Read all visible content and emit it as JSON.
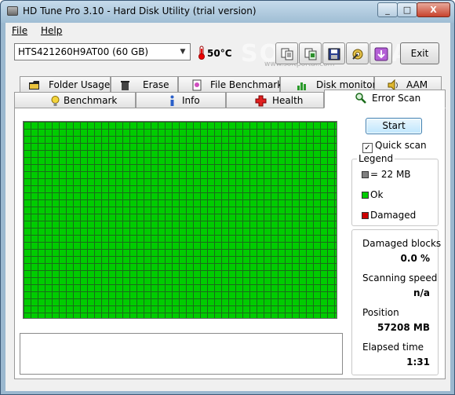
{
  "window": {
    "title": "HD Tune Pro 3.10 - Hard Disk Utility (trial version)",
    "minimize": "_",
    "maximize": "□",
    "close": "X"
  },
  "menu": {
    "file": "File",
    "help": "Help"
  },
  "toolbar": {
    "drive": "HTS421260H9AT00 (60 GB)",
    "temperature": "50°C",
    "exit_label": "Exit",
    "watermark": "SOFTPORTAL",
    "watermark_sub": "www.softportal.com",
    "icons": [
      "copy-icon",
      "copy-screenshot-icon",
      "save-icon",
      "options-icon",
      "download-icon"
    ]
  },
  "tabs": {
    "row1": [
      {
        "label": "Folder Usage",
        "icon": "folder-icon"
      },
      {
        "label": "Erase",
        "icon": "trash-icon"
      },
      {
        "label": "File Benchmark",
        "icon": "file-benchmark-icon"
      },
      {
        "label": "Disk monitor",
        "icon": "disk-monitor-icon"
      },
      {
        "label": "AAM",
        "icon": "speaker-icon"
      }
    ],
    "row2": [
      {
        "label": "Benchmark",
        "icon": "lightbulb-icon"
      },
      {
        "label": "Info",
        "icon": "info-icon"
      },
      {
        "label": "Health",
        "icon": "health-cross-icon"
      },
      {
        "label": "Error Scan",
        "icon": "magnifier-icon",
        "active": true
      }
    ]
  },
  "scan": {
    "start_label": "Start",
    "quick_scan_label": "Quick scan",
    "quick_scan_checked": true,
    "legend_title": "Legend",
    "legend": [
      {
        "label": "= 22 MB",
        "color": "#808080"
      },
      {
        "label": "Ok",
        "color": "#00cc00"
      },
      {
        "label": "Damaged",
        "color": "#cc0000"
      }
    ],
    "grid_color": "#00cc00",
    "stats": {
      "damaged_blocks_label": "Damaged blocks",
      "damaged_blocks_value": "0.0 %",
      "scanning_speed_label": "Scanning speed",
      "scanning_speed_value": "n/a",
      "position_label": "Position",
      "position_value": "57208 MB",
      "elapsed_label": "Elapsed time",
      "elapsed_value": "1:31"
    }
  }
}
